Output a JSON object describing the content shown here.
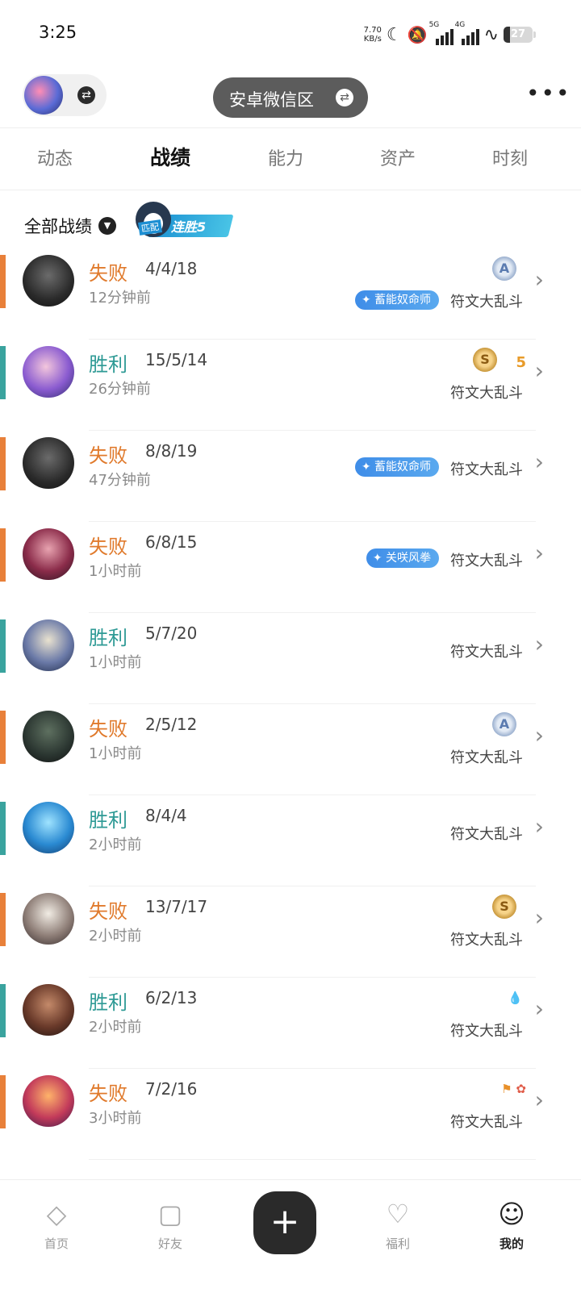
{
  "status": {
    "time": "3:25",
    "speed": "7.70",
    "speed_unit": "KB/s",
    "sig1": "5G",
    "sig2": "4G",
    "battery": "27"
  },
  "header": {
    "region": "安卓微信区",
    "more": "•••"
  },
  "tabs": [
    "动态",
    "战绩",
    "能力",
    "资产",
    "时刻"
  ],
  "active_tab": 1,
  "filter": {
    "label": "全部战绩",
    "streak_tag": "匹配",
    "streak_text": "连胜5"
  },
  "matches": [
    {
      "result": "失败",
      "outcome": "loss",
      "kda": "4/4/18",
      "ago": "12分钟前",
      "mode": "符文大乱斗",
      "badge": "蓄能奴命师",
      "medal": "A",
      "extra": ""
    },
    {
      "result": "胜利",
      "outcome": "win",
      "kda": "15/5/14",
      "ago": "26分钟前",
      "mode": "符文大乱斗",
      "badge": "",
      "medal": "S",
      "extra": "5"
    },
    {
      "result": "失败",
      "outcome": "loss",
      "kda": "8/8/19",
      "ago": "47分钟前",
      "mode": "符文大乱斗",
      "badge": "蓄能奴命师",
      "medal": "",
      "extra": ""
    },
    {
      "result": "失败",
      "outcome": "loss",
      "kda": "6/8/15",
      "ago": "1小时前",
      "mode": "符文大乱斗",
      "badge": "关咲风拳",
      "medal": "",
      "extra": ""
    },
    {
      "result": "胜利",
      "outcome": "win",
      "kda": "5/7/20",
      "ago": "1小时前",
      "mode": "符文大乱斗",
      "badge": "",
      "medal": "",
      "extra": ""
    },
    {
      "result": "失败",
      "outcome": "loss",
      "kda": "2/5/12",
      "ago": "1小时前",
      "mode": "符文大乱斗",
      "badge": "",
      "medal": "A",
      "extra": ""
    },
    {
      "result": "胜利",
      "outcome": "win",
      "kda": "8/4/4",
      "ago": "2小时前",
      "mode": "符文大乱斗",
      "badge": "",
      "medal": "",
      "extra": ""
    },
    {
      "result": "失败",
      "outcome": "loss",
      "kda": "13/7/17",
      "ago": "2小时前",
      "mode": "符文大乱斗",
      "badge": "",
      "medal": "S",
      "extra": ""
    },
    {
      "result": "胜利",
      "outcome": "win",
      "kda": "6/2/13",
      "ago": "2小时前",
      "mode": "符文大乱斗",
      "badge": "",
      "medal": "",
      "extra": "blood-icon"
    },
    {
      "result": "失败",
      "outcome": "loss",
      "kda": "7/2/16",
      "ago": "3小时前",
      "mode": "符文大乱斗",
      "badge": "",
      "medal": "",
      "extra": "flag-icon"
    }
  ],
  "bottom_nav": [
    {
      "label": "首页",
      "icon": "home-icon"
    },
    {
      "label": "好友",
      "icon": "chat-icon"
    },
    {
      "label": "福利",
      "icon": "gift-icon"
    },
    {
      "label": "我的",
      "icon": "user-icon"
    }
  ],
  "colors": {
    "win": "#2e9a95",
    "loss": "#e07a2c",
    "badge": "#3f8de8"
  }
}
